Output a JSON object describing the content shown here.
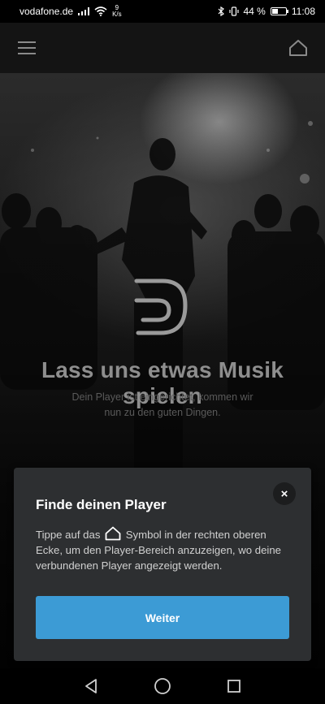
{
  "status_bar": {
    "carrier": "vodafone.de",
    "net_speed_value": "9",
    "net_speed_unit": "K/s",
    "battery_percent": "44 %",
    "battery_level": 0.44,
    "time": "11:08",
    "icons": [
      "signal-icon",
      "wifi-icon",
      "bluetooth-icon",
      "vibrate-icon",
      "battery-icon"
    ]
  },
  "app_bar": {
    "left_icon": "hamburger-menu-icon",
    "right_icon": "home-icon"
  },
  "hero": {
    "title": "Lass uns etwas Musik spielen",
    "subtitle": "Dein Player ist eingerichtet, kommen wir nun zu den guten Dingen."
  },
  "dialog": {
    "title": "Finde deinen Player",
    "body_before_icon": "Tippe auf das",
    "body_after_icon": "Symbol in der rechten oberen Ecke, um den Player-Bereich anzuzeigen, wo deine verbundenen Player angezeigt werden.",
    "inline_icon": "home-icon",
    "close_label": "×",
    "primary_button": "Weiter"
  },
  "nav_bar": {
    "icons": [
      "back-icon",
      "home-circle-icon",
      "recents-icon"
    ]
  },
  "colors": {
    "accent": "#3c9bd5",
    "card": "#2d2f31",
    "app_bar": "#141414"
  }
}
